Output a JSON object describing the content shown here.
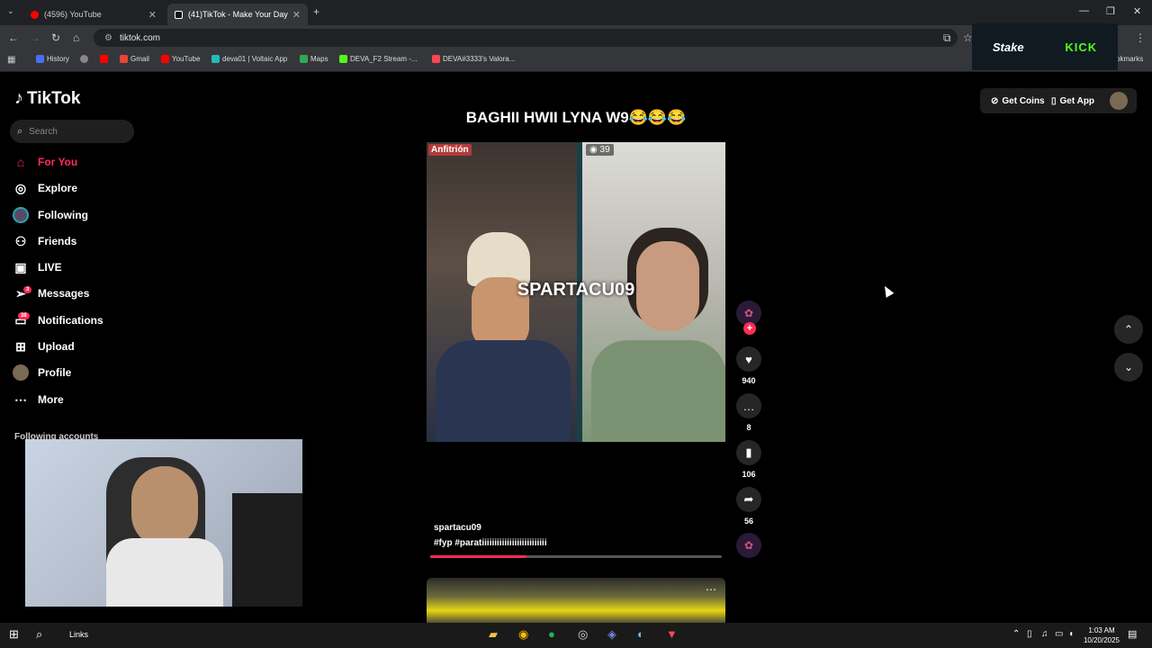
{
  "browser": {
    "tabs": [
      {
        "label": "(4596) YouTube"
      },
      {
        "label": "(41)TikTok - Make Your Day"
      }
    ],
    "url": "tiktok.com",
    "bookmarks": [
      "History",
      "Gmail",
      "YouTube",
      "deva01 | Voltaic App",
      "Maps",
      "DEVA_F2 Stream -...",
      "DEVA#3333's Valora..."
    ],
    "bookmarks_right": "okmarks",
    "ad": {
      "left": "Stake",
      "right": "KICK"
    }
  },
  "tiktok": {
    "logo": "TikTok",
    "search_placeholder": "Search",
    "nav": [
      {
        "label": "For You",
        "icon": "home-icon"
      },
      {
        "label": "Explore",
        "icon": "compass-icon"
      },
      {
        "label": "Following",
        "icon": "avatar"
      },
      {
        "label": "Friends",
        "icon": "friends-icon"
      },
      {
        "label": "LIVE",
        "icon": "live-icon"
      },
      {
        "label": "Messages",
        "icon": "send-icon",
        "badge": "3"
      },
      {
        "label": "Notifications",
        "icon": "inbox-icon",
        "badge": "38"
      },
      {
        "label": "Upload",
        "icon": "plus-square-icon"
      },
      {
        "label": "Profile",
        "icon": "avatar"
      },
      {
        "label": "More",
        "icon": "more-icon"
      }
    ],
    "following_accounts_label": "Following accounts",
    "get_coins": "Get Coins",
    "get_app": "Get App",
    "accent": "#fe2c55"
  },
  "video": {
    "title": "BAGHII HWII LYNA W9😂😂😂",
    "host_label": "Anfitrión",
    "viewers": "39",
    "overlay_name": "SPARTACU09",
    "username": "spartacu09",
    "caption": "#fyp #paratiiiiiiiiiiiiiiiiiiiiiiiiii",
    "progress": 0.33,
    "likes": "940",
    "comments": "8",
    "saves": "106",
    "shares": "56"
  },
  "taskbar": {
    "links_label": "Links",
    "time": "1:03 AM",
    "date": "10/20/2025"
  }
}
